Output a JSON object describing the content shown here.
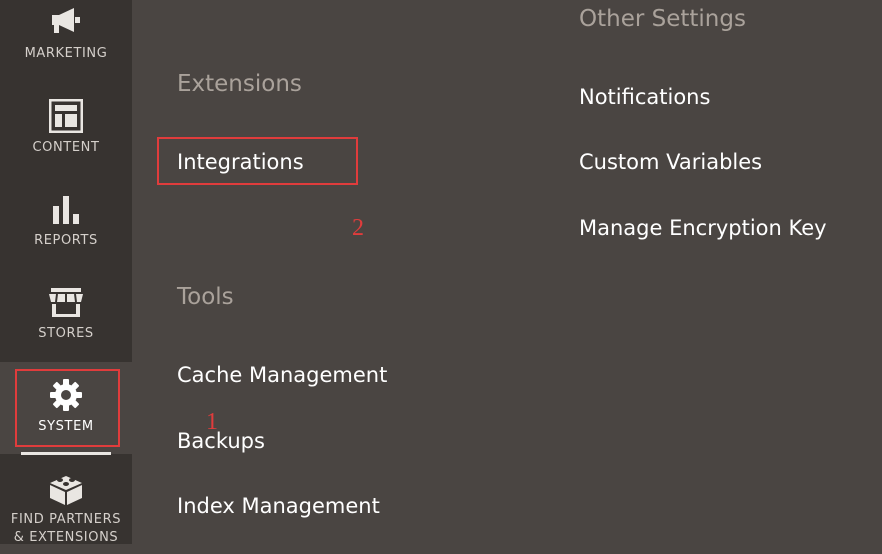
{
  "sidebar": {
    "items": [
      {
        "label": "MARKETING",
        "icon": "megaphone-icon"
      },
      {
        "label": "CONTENT",
        "icon": "layout-icon"
      },
      {
        "label": "REPORTS",
        "icon": "bar-chart-icon"
      },
      {
        "label": "STORES",
        "icon": "storefront-icon"
      },
      {
        "label": "SYSTEM",
        "icon": "gear-icon",
        "active": true
      },
      {
        "label_line1": "FIND PARTNERS",
        "label_line2": "& EXTENSIONS",
        "icon": "lego-brick-icon"
      }
    ]
  },
  "menu": {
    "extensions": {
      "title": "Extensions",
      "links": [
        "Integrations"
      ]
    },
    "tools": {
      "title": "Tools",
      "links": [
        "Cache Management",
        "Backups",
        "Index Management"
      ]
    },
    "other_settings": {
      "title": "Other Settings",
      "links": [
        "Notifications",
        "Custom Variables",
        "Manage Encryption Key"
      ]
    }
  },
  "annotations": {
    "step1": "1",
    "step2": "2"
  },
  "colors": {
    "sidebar_bg": "#373330",
    "panel_bg": "#4a4542",
    "highlight": "#e03c3c",
    "section_title": "#aaa29b"
  }
}
